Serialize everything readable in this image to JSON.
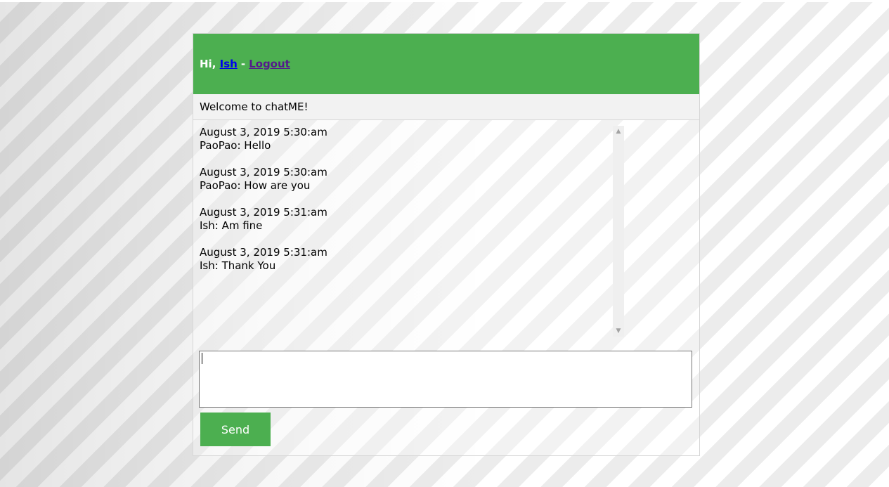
{
  "header": {
    "greeting": "Hi,",
    "username": "Ish",
    "separator": "-",
    "logout_label": "Logout"
  },
  "welcome": {
    "text": "Welcome to chatME!"
  },
  "messages": [
    {
      "timestamp": "August 3, 2019 5:30:am",
      "text": "PaoPao: Hello"
    },
    {
      "timestamp": "August 3, 2019 5:30:am",
      "text": "PaoPao: How are you"
    },
    {
      "timestamp": "August 3, 2019 5:31:am",
      "text": "Ish: Am fine"
    },
    {
      "timestamp": "August 3, 2019 5:31:am",
      "text": "Ish: Thank You"
    }
  ],
  "scrollbar": {
    "up_icon": "chevron-up-icon",
    "down_icon": "chevron-down-icon"
  },
  "input": {
    "value": "",
    "placeholder": ""
  },
  "send_button": {
    "label": "Send"
  },
  "colors": {
    "accent": "#4caf50",
    "link": "#0000ee",
    "visited_link": "#551a8b"
  }
}
